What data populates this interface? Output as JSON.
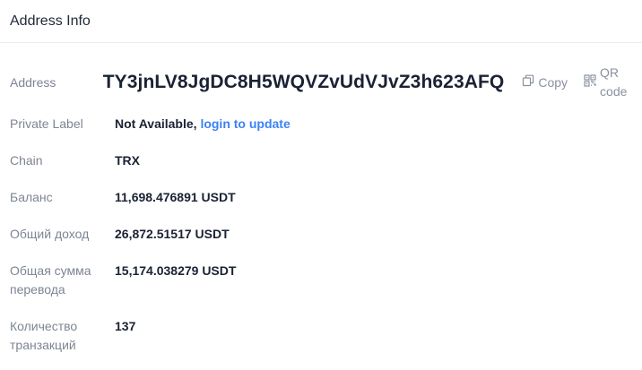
{
  "header": {
    "title": "Address Info"
  },
  "address": {
    "label": "Address",
    "value": "TY3jnLV8JgDC8H5WQVZvUdVJvZ3h623AFQ",
    "copy_label": "Copy",
    "qr_label": "QR code",
    "copy_icon": "copy-icon",
    "qr_icon": "qr-code-icon"
  },
  "private_label": {
    "label": "Private Label",
    "value": "Not Available,",
    "link": "login to update"
  },
  "chain": {
    "label": "Chain",
    "value": "TRX"
  },
  "balance": {
    "label": "Баланс",
    "value": "11,698.476891 USDT"
  },
  "total_income": {
    "label": "Общий доход",
    "value": "26,872.51517 USDT"
  },
  "total_transfer": {
    "label_line1": "Общая сумма",
    "label_line2": "перевода",
    "value": "15,174.038279 USDT"
  },
  "tx_count": {
    "label_line1": "Количество",
    "label_line2": "транзакций",
    "value": "137"
  },
  "colors": {
    "link": "#3b82f6",
    "label": "#7d8593",
    "value": "#1a2233",
    "action": "#8a919e"
  }
}
